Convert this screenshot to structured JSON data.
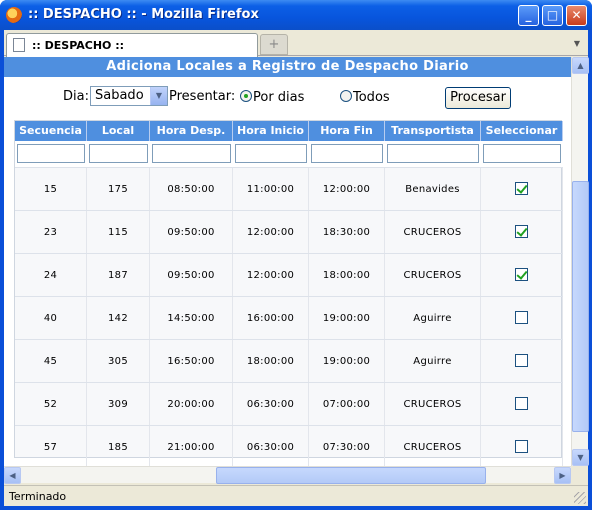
{
  "window": {
    "title": ":: DESPACHO :: - Mozilla Firefox",
    "minimize_glyph": "_",
    "maximize_glyph": "□",
    "close_glyph": "✕"
  },
  "tabs": {
    "active_label": ":: DESPACHO ::",
    "new_tab_glyph": "+"
  },
  "page": {
    "banner": "Adiciona Locales a Registro de Despacho Diario",
    "dia_label": "Dia:",
    "dia_value": "Sabado",
    "presentar_label": "Presentar:",
    "option_dias": "Por dias",
    "option_todos": "Todos",
    "option_dias_selected": true,
    "procesar_label": "Procesar"
  },
  "table": {
    "headers": [
      "Secuencia",
      "Local",
      "Hora Desp.",
      "Hora Inicio",
      "Hora Fin",
      "Transportista",
      "Seleccionar"
    ],
    "rows": [
      {
        "secuencia": "15",
        "local": "175",
        "hora_desp": "08:50:00",
        "hora_inicio": "11:00:00",
        "hora_fin": "12:00:00",
        "transportista": "Benavides",
        "selected": true
      },
      {
        "secuencia": "23",
        "local": "115",
        "hora_desp": "09:50:00",
        "hora_inicio": "12:00:00",
        "hora_fin": "18:30:00",
        "transportista": "CRUCEROS",
        "selected": true
      },
      {
        "secuencia": "24",
        "local": "187",
        "hora_desp": "09:50:00",
        "hora_inicio": "12:00:00",
        "hora_fin": "18:00:00",
        "transportista": "CRUCEROS",
        "selected": true
      },
      {
        "secuencia": "40",
        "local": "142",
        "hora_desp": "14:50:00",
        "hora_inicio": "16:00:00",
        "hora_fin": "19:00:00",
        "transportista": "Aguirre",
        "selected": false
      },
      {
        "secuencia": "45",
        "local": "305",
        "hora_desp": "16:50:00",
        "hora_inicio": "18:00:00",
        "hora_fin": "19:00:00",
        "transportista": "Aguirre",
        "selected": false
      },
      {
        "secuencia": "52",
        "local": "309",
        "hora_desp": "20:00:00",
        "hora_inicio": "06:30:00",
        "hora_fin": "07:00:00",
        "transportista": "CRUCEROS",
        "selected": false
      },
      {
        "secuencia": "57",
        "local": "185",
        "hora_desp": "21:00:00",
        "hora_inicio": "06:30:00",
        "hora_fin": "07:30:00",
        "transportista": "CRUCEROS",
        "selected": false
      }
    ]
  },
  "status": {
    "text": "Terminado"
  },
  "colors": {
    "header_blue": "#4f8fdf",
    "titlebar_blue": "#0855dd",
    "check_green": "#21a121"
  }
}
